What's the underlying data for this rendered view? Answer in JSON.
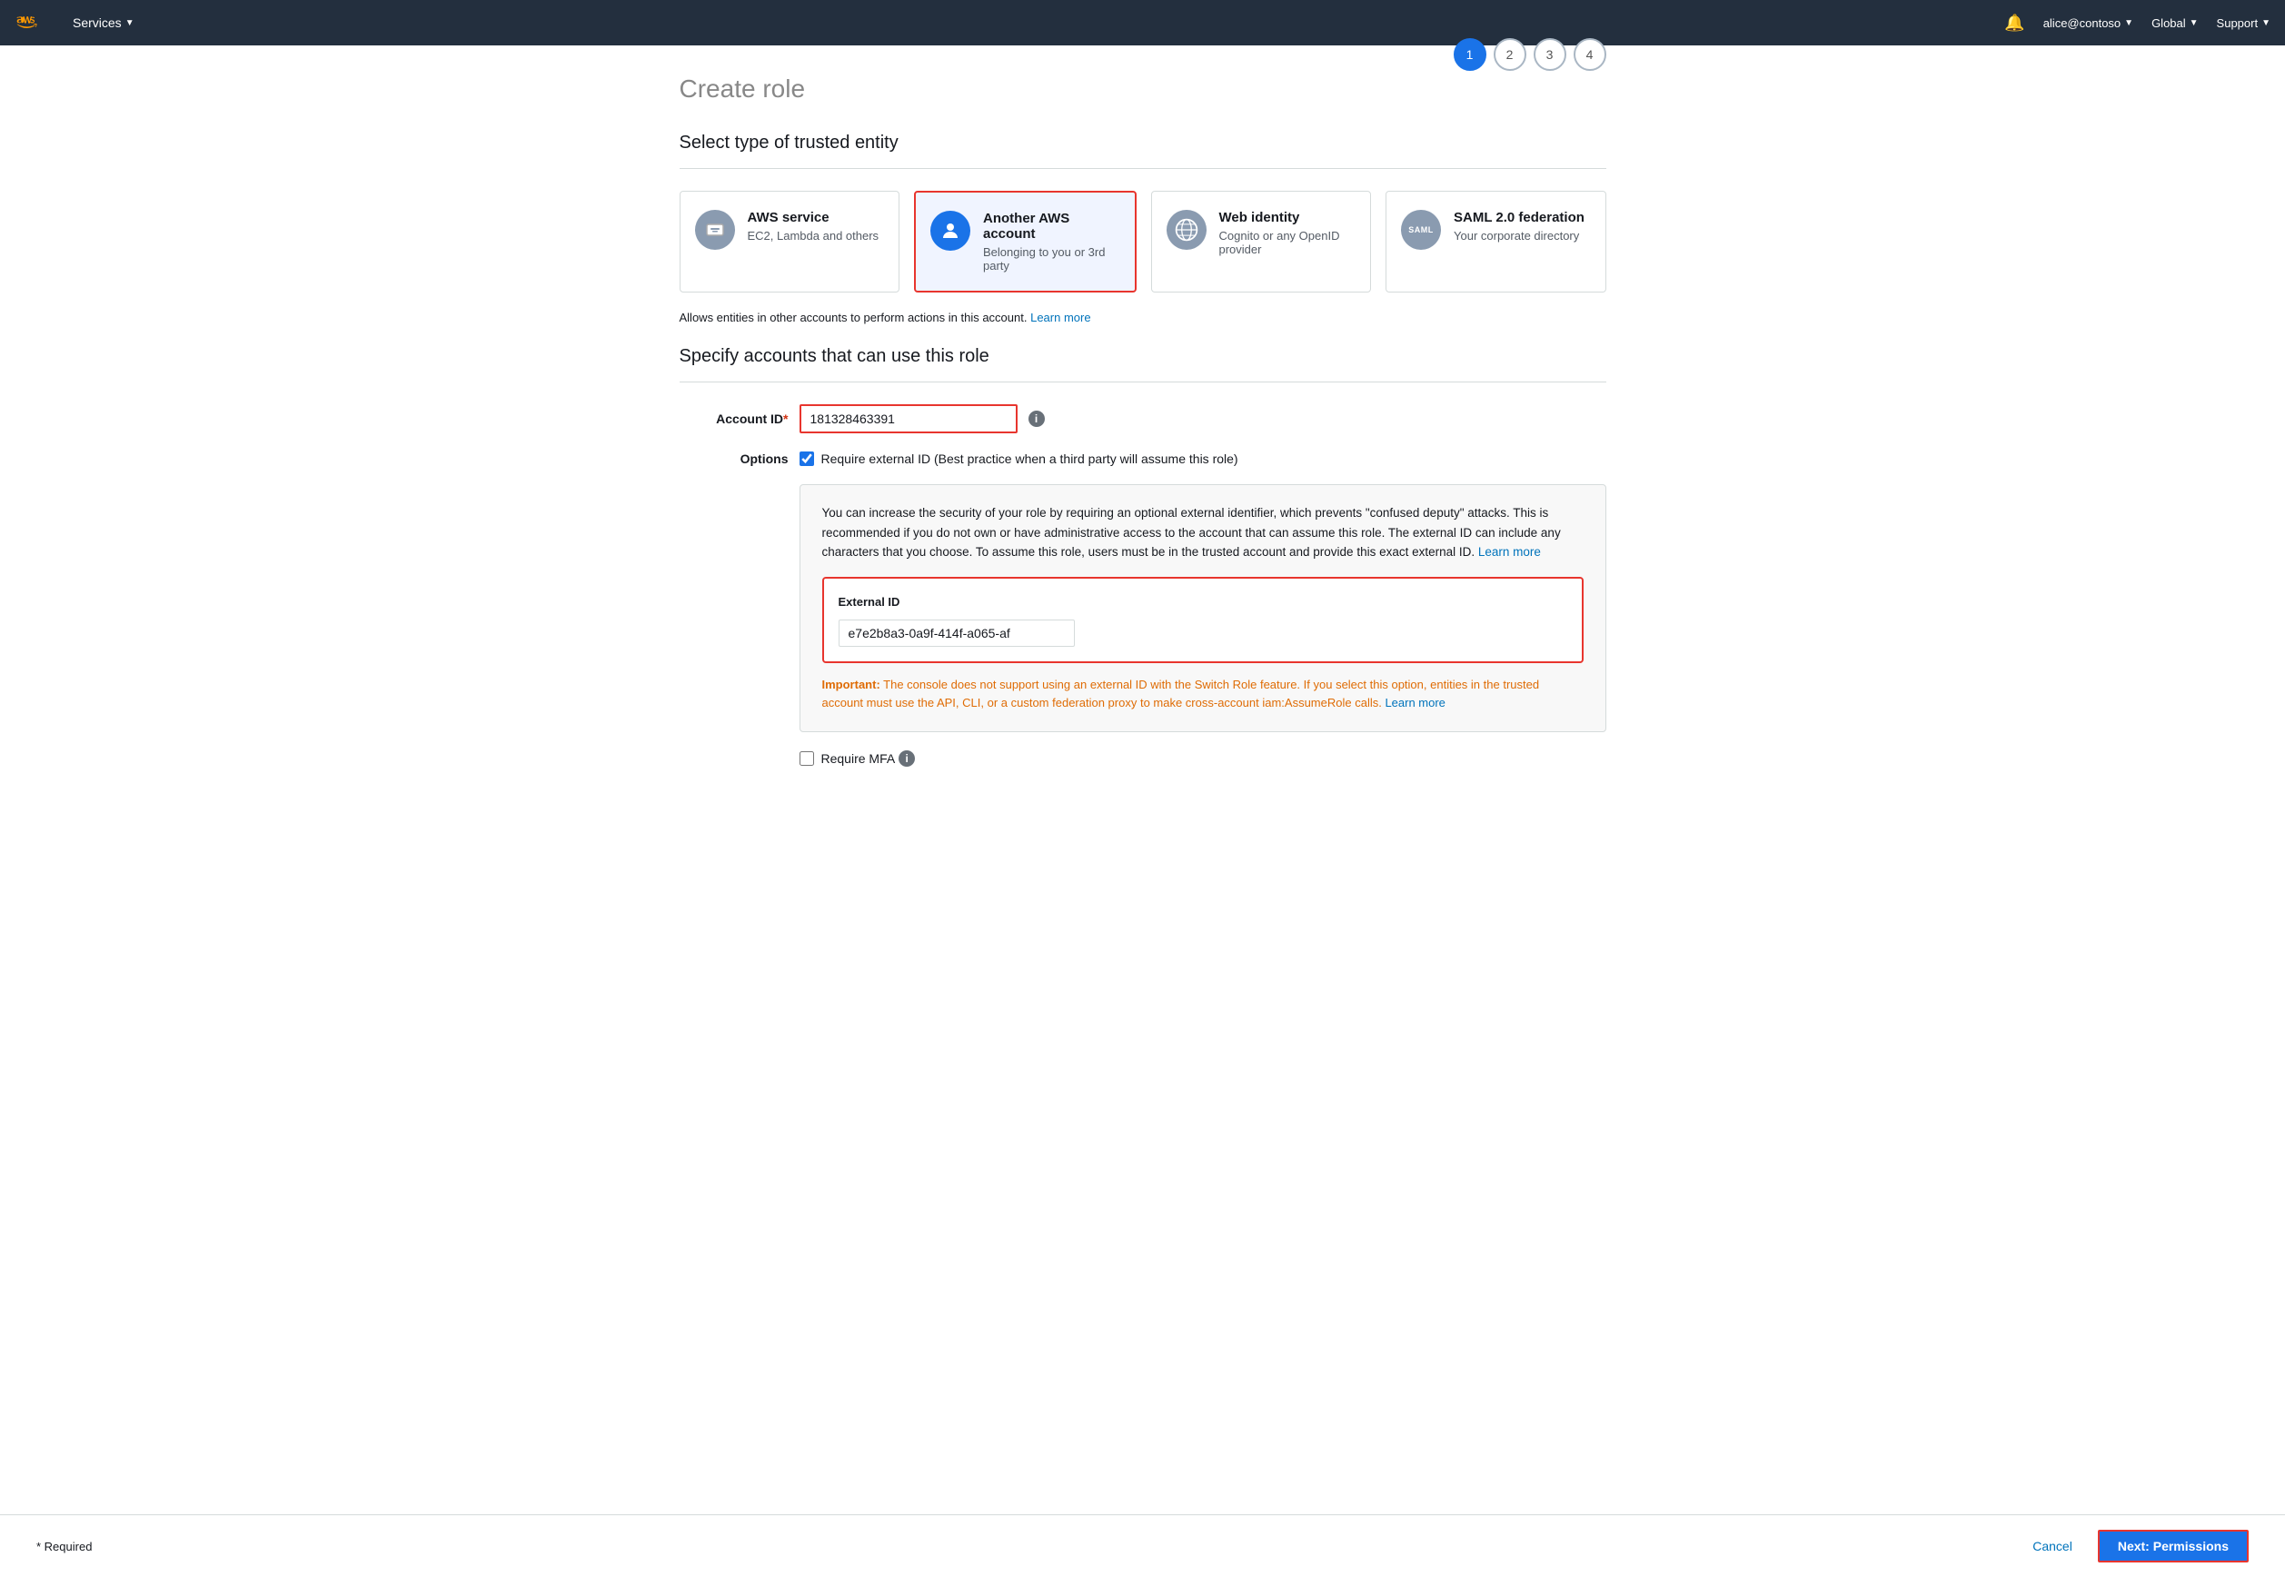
{
  "navbar": {
    "services_label": "Services",
    "bell_label": "🔔",
    "user_label": "alice@contoso",
    "region_label": "Global",
    "support_label": "Support"
  },
  "page": {
    "title": "Create role",
    "step1_label": "1",
    "step2_label": "2",
    "step3_label": "3",
    "step4_label": "4"
  },
  "section1": {
    "header": "Select type of trusted entity"
  },
  "entity_types": [
    {
      "id": "aws-service",
      "title": "AWS service",
      "subtitle": "EC2, Lambda and others",
      "selected": false
    },
    {
      "id": "another-aws-account",
      "title": "Another AWS account",
      "subtitle": "Belonging to you or 3rd party",
      "selected": true
    },
    {
      "id": "web-identity",
      "title": "Web identity",
      "subtitle": "Cognito or any OpenID provider",
      "selected": false
    },
    {
      "id": "saml-federation",
      "title": "SAML 2.0 federation",
      "subtitle": "Your corporate directory",
      "selected": false
    }
  ],
  "info_text": "Allows entities in other accounts to perform actions in this account.",
  "info_link": "Learn more",
  "section2": {
    "header": "Specify accounts that can use this role"
  },
  "form": {
    "account_id_label": "Account ID",
    "account_id_value": "181328463391",
    "account_id_placeholder": "",
    "options_label": "Options",
    "require_external_id_label": "Require external ID (Best practice when a third party will assume this role)",
    "external_id_label": "External ID",
    "external_id_value": "e7e2b8a3-0a9f-414f-a065-af",
    "require_mfa_label": "Require MFA",
    "info_box_text": "You can increase the security of your role by requiring an optional external identifier, which prevents \"confused deputy\" attacks. This is recommended if you do not own or have administrative access to the account that can assume this role. The external ID can include any characters that you choose. To assume this role, users must be in the trusted account and provide this exact external ID.",
    "info_box_link": "Learn more",
    "important_prefix": "Important:",
    "important_text": "The console does not support using an external ID with the Switch Role feature. If you select this option, entities in the trusted account must use the API, CLI, or a custom federation proxy to make cross-account iam:AssumeRole calls.",
    "important_link": "Learn more"
  },
  "footer": {
    "required_note": "* Required",
    "cancel_label": "Cancel",
    "next_label": "Next: Permissions"
  }
}
